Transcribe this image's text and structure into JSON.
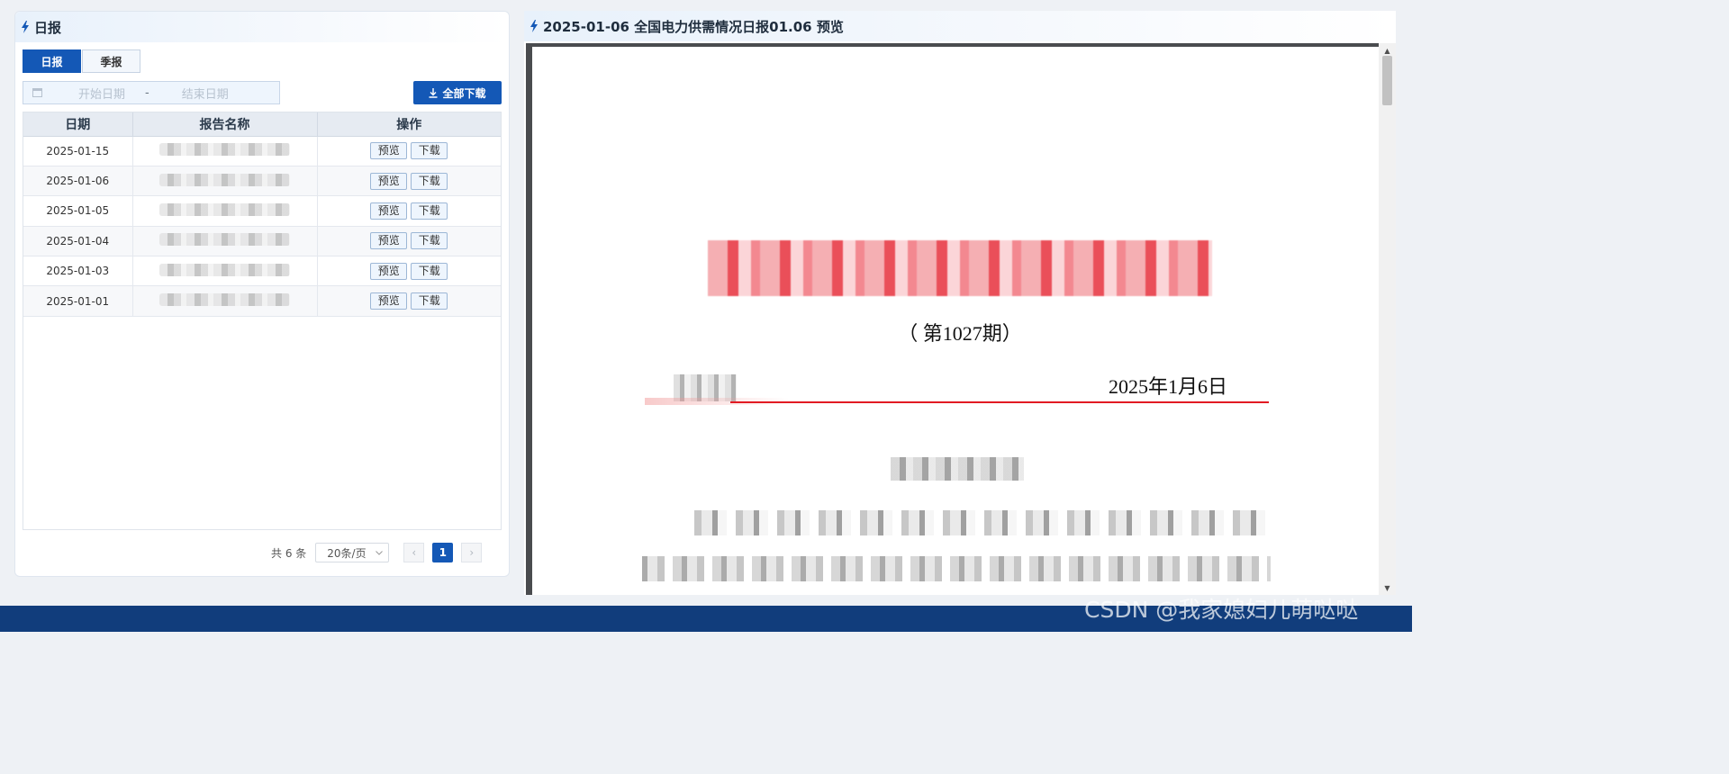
{
  "left_panel": {
    "title": "日报",
    "tabs": [
      {
        "label": "日报",
        "active": true
      },
      {
        "label": "季报",
        "active": false
      }
    ],
    "date_range": {
      "start_placeholder": "开始日期",
      "separator": "-",
      "end_placeholder": "结束日期"
    },
    "download_all_label": "全部下载",
    "table": {
      "headers": [
        "日期",
        "报告名称",
        "操作"
      ],
      "rows": [
        {
          "date": "2025-01-15",
          "name": ""
        },
        {
          "date": "2025-01-06",
          "name": ""
        },
        {
          "date": "2025-01-05",
          "name": ""
        },
        {
          "date": "2025-01-04",
          "name": ""
        },
        {
          "date": "2025-01-03",
          "name": ""
        },
        {
          "date": "2025-01-01",
          "name": ""
        }
      ],
      "action_preview": "预览",
      "action_download": "下载"
    },
    "pagination": {
      "total": "共 6 条",
      "page_size": "20条/页",
      "current_page": "1",
      "prev": "‹",
      "next": "›"
    }
  },
  "right_panel": {
    "title": "2025-01-06 全国电力供需情况日报01.06 预览",
    "document": {
      "issue": "（ 第1027期）",
      "date": "2025年1月6日"
    }
  },
  "watermark": "CSDN @我家媳妇儿萌哒哒",
  "colors": {
    "primary": "#1458b6",
    "bottom_bar": "#113d7c",
    "doc_red": "#e21b23"
  }
}
